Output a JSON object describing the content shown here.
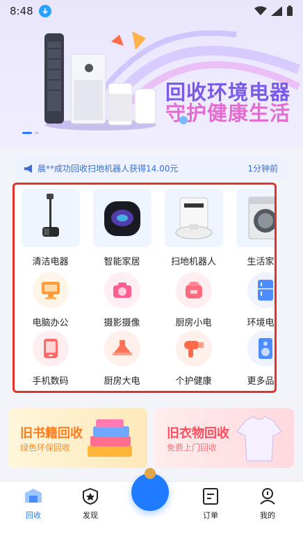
{
  "status_bar": {
    "time": "8:48"
  },
  "banner": {
    "title": "回收环境电器",
    "subtitle": "守护健康生活"
  },
  "notice": {
    "message": "晨**成功回收扫地机器人获得14.00元",
    "time": "1分钟前"
  },
  "categories": {
    "row1": [
      {
        "label": "清洁电器",
        "icon": "vacuum-icon"
      },
      {
        "label": "智能家居",
        "icon": "smart-speaker-icon"
      },
      {
        "label": "扫地机器人",
        "icon": "robot-vacuum-icon"
      },
      {
        "label": "生活家电",
        "icon": "washing-machine-icon"
      }
    ],
    "row2": [
      {
        "label": "电脑办公",
        "icon": "computer-icon"
      },
      {
        "label": "摄影摄像",
        "icon": "camera-icon"
      },
      {
        "label": "厨房小电",
        "icon": "rice-cooker-icon"
      },
      {
        "label": "环境电器",
        "icon": "fridge-icon"
      }
    ],
    "row3": [
      {
        "label": "手机数码",
        "icon": "phone-icon"
      },
      {
        "label": "厨房大电",
        "icon": "range-hood-icon"
      },
      {
        "label": "个护健康",
        "icon": "hair-dryer-icon"
      },
      {
        "label": "更多品类",
        "icon": "speaker-icon"
      }
    ]
  },
  "promos": [
    {
      "title": "旧书籍回收",
      "subtitle": "绿色环保回收"
    },
    {
      "title": "旧衣物回收",
      "subtitle": "免费上门回收"
    }
  ],
  "tabs": [
    {
      "label": "回收",
      "icon": "recycle-icon",
      "active": true
    },
    {
      "label": "发现",
      "icon": "badge-icon",
      "active": false
    },
    {
      "label": "订单",
      "icon": "order-icon",
      "active": false
    },
    {
      "label": "我的",
      "icon": "profile-icon",
      "active": false
    }
  ],
  "colors": {
    "accent": "#1f7bff",
    "highlight_frame": "#e8302a",
    "banner_title": "#7a5ae8",
    "banner_subtitle": "#e46bd0"
  }
}
